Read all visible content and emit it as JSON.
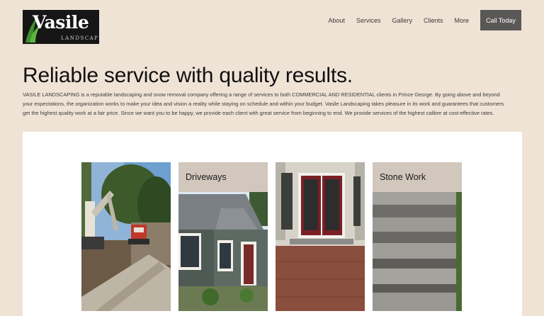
{
  "brand": {
    "name": "Vasile",
    "tagline": "LANDSCAPING"
  },
  "nav": {
    "items": [
      "About",
      "Services",
      "Gallery",
      "Clients",
      "More"
    ],
    "cta": "Call Today"
  },
  "hero": {
    "headline": "Reliable service with quality results.",
    "intro": "VASILE LANDSCAPING is a reputable landscaping and snow removal company offering a range of services to both COMMERCIAL AND RESIDENTIAL clients in Prince George. By going above and beyond your expectations, the organization works to make your idea and vision a reality while staying on schedule and within your budget. Vasile Landscaping takes pleasure in its work and guarantees that customers get the highest quality work at a fair price. Since we want you to be happy, we provide each client with great service from beginning to end. We provide services of the highest calibre at cost-effective rates."
  },
  "gallery": {
    "cards": [
      {
        "caption": "",
        "image": "excavator-retaining-wall-photo"
      },
      {
        "caption": "Driveways",
        "image": "house-driveway-photo"
      },
      {
        "caption": "",
        "image": "red-french-doors-photo"
      },
      {
        "caption": "Stone Work",
        "image": "stone-steps-photo"
      }
    ]
  },
  "colors": {
    "background": "#efe3d6",
    "cta": "#5a5857",
    "caption_bg": "#d2c7bd",
    "logo_bg": "#161616"
  }
}
